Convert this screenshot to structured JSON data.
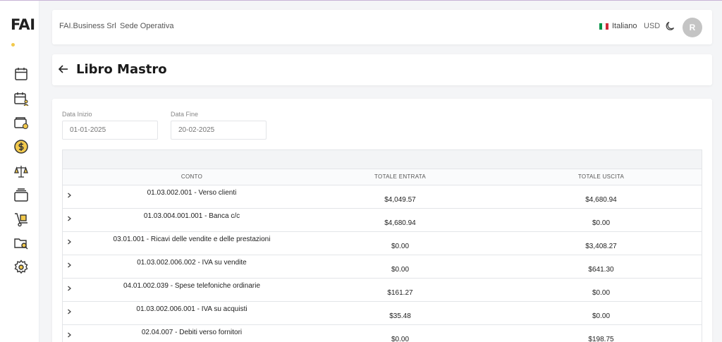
{
  "sidebar": {
    "logo": "FAI",
    "items": [
      {
        "icon": "calendar-icon"
      },
      {
        "icon": "calendar-user-icon"
      },
      {
        "icon": "wallet-icon"
      },
      {
        "icon": "dollar-coin-icon"
      },
      {
        "icon": "balance-scale-icon"
      },
      {
        "icon": "cards-stack-icon"
      },
      {
        "icon": "hand-truck-icon"
      },
      {
        "icon": "folder-search-icon"
      },
      {
        "icon": "gear-icon"
      }
    ]
  },
  "header": {
    "company": "FAI.Business Srl",
    "site": "Sede Operativa",
    "language": "Italiano",
    "currency": "USD",
    "avatar_initial": "R"
  },
  "page": {
    "title": "Libro Mastro"
  },
  "filters": {
    "start_label": "Data Inizio",
    "start_value": "01-01-2025",
    "end_label": "Data Fine",
    "end_value": "20-02-2025"
  },
  "table": {
    "headers": [
      "CONTO",
      "TOTALE ENTRATA",
      "TOTALE USCITA"
    ],
    "rows": [
      {
        "account": "01.03.002.001 - Verso clienti",
        "entrata": "$4,049.57",
        "uscita": "$4,680.94"
      },
      {
        "account": "01.03.004.001.001 - Banca c/c",
        "entrata": "$4,680.94",
        "uscita": "$0.00"
      },
      {
        "account": "03.01.001 - Ricavi delle vendite e delle prestazioni",
        "entrata": "$0.00",
        "uscita": "$3,408.27"
      },
      {
        "account": "01.03.002.006.002 - IVA su vendite",
        "entrata": "$0.00",
        "uscita": "$641.30"
      },
      {
        "account": "04.01.002.039 - Spese telefoniche ordinarie",
        "entrata": "$161.27",
        "uscita": "$0.00"
      },
      {
        "account": "01.03.002.006.001 - IVA su acquisti",
        "entrata": "$35.48",
        "uscita": "$0.00"
      },
      {
        "account": "02.04.007 - Debiti verso fornitori",
        "entrata": "$0.00",
        "uscita": "$198.75"
      }
    ]
  },
  "colors": {
    "accent": "#f2c94c",
    "page_bg": "#f4f5f7",
    "icon_stroke": "#333333"
  }
}
